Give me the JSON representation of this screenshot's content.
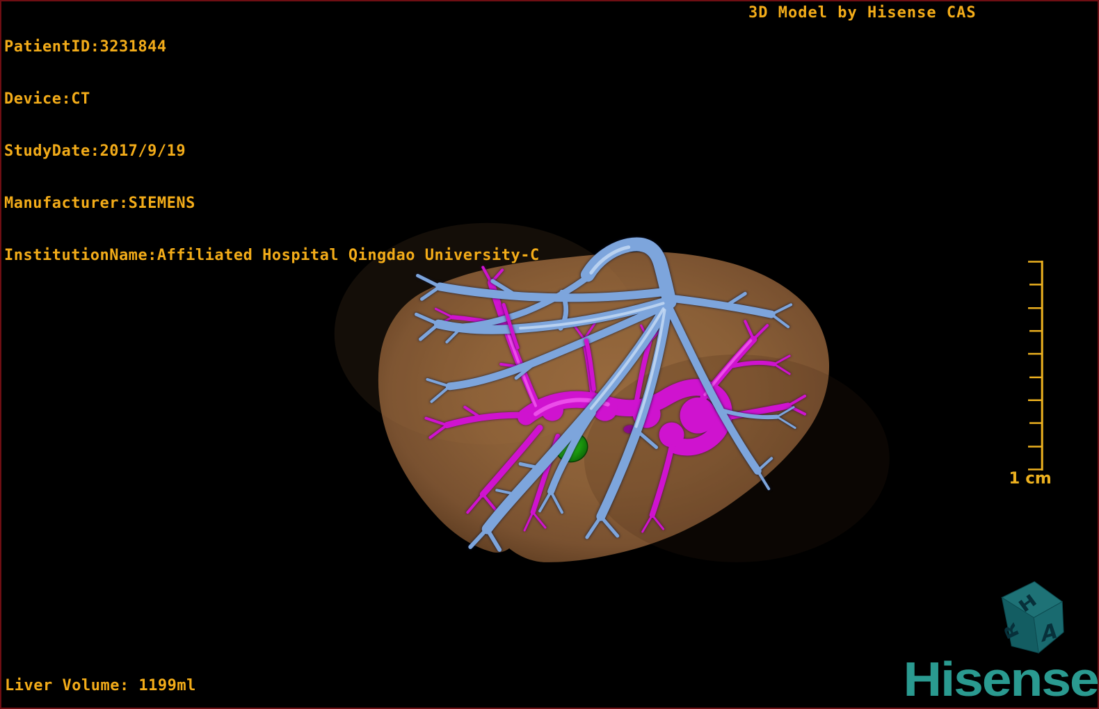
{
  "overlay": {
    "patient_lines": [
      "PatientID:3231844",
      "Device:CT",
      "StudyDate:2017/9/19",
      "Manufacturer:SIEMENS",
      "InstitutionName:Affiliated Hospital Qingdao University-C"
    ],
    "watermark": "3D Model by Hisense CAS",
    "liver_volume": "Liver Volume: 1199ml",
    "scale_label": "1 cm"
  },
  "brand": {
    "wordmark": "Hisense",
    "wordmark_color": "#2a9a90",
    "cube": {
      "top_letter": "H",
      "left_letter": "R",
      "right_letter": "A"
    }
  },
  "model": {
    "structures": [
      {
        "name": "liver-surface",
        "color": "#8a5f37"
      },
      {
        "name": "portal-hepatic-vein-tree",
        "color": "#7da5dc"
      },
      {
        "name": "hepatic-artery-tree",
        "color": "#cf13cf"
      },
      {
        "name": "lesion-gallbladder",
        "color": "#1f9e10"
      }
    ]
  },
  "colors": {
    "overlay_text": "#f3ac19",
    "scale_bar": "#edb11f",
    "frame_border": "#6f0e13",
    "background": "#000000"
  }
}
